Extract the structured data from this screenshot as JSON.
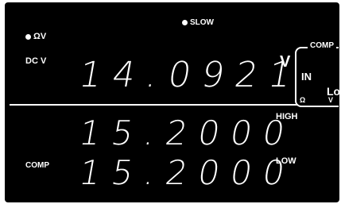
{
  "indicators": {
    "slow": "SLOW",
    "ohm_v": "ΩV"
  },
  "labels": {
    "dc_v": "DC V",
    "unit_v": "V",
    "high": "HIGH",
    "low": "LOW",
    "comp": "COMP"
  },
  "comp_panel": {
    "title": "COMP",
    "in": "IN",
    "lo": "Lo",
    "omega": "Ω",
    "v": "V"
  },
  "readings": {
    "main": "14.0921",
    "high": "15.2000",
    "low": "15.2000"
  },
  "colors": {
    "background": "#000000",
    "foreground": "#ffffff"
  }
}
